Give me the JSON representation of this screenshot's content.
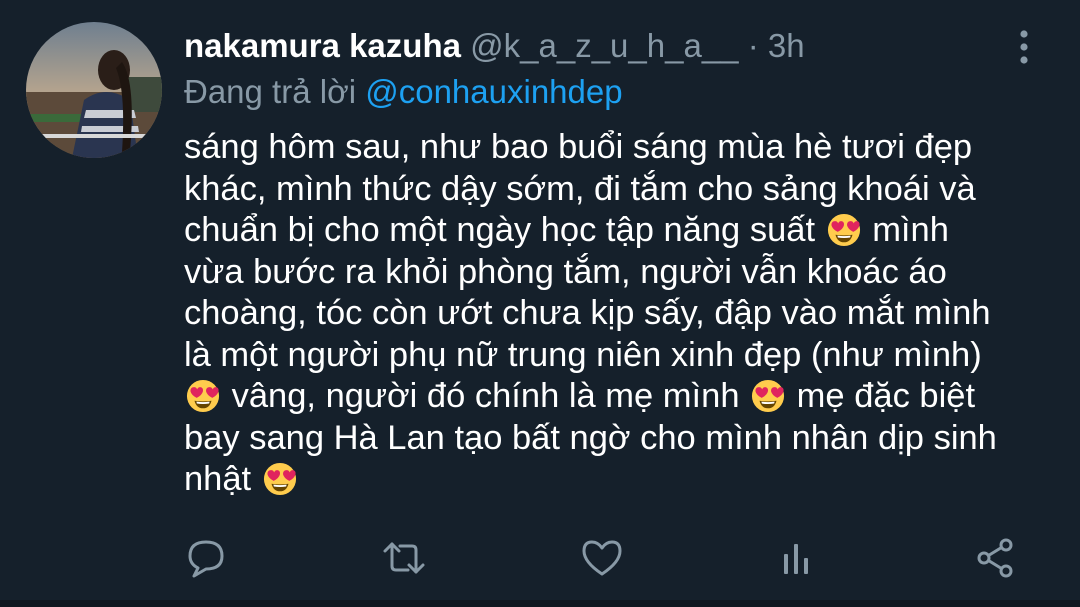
{
  "tweet": {
    "display_name": "nakamura kazuha",
    "handle": "@k_a_z_u_h_a__",
    "separator": "·",
    "time": "3h",
    "reply_prefix": "Đang trả lời",
    "reply_to": "@conhauxinhdep",
    "body_lines": [
      [
        "sáng hôm sau, như bao buổi sáng mùa hè tươi đẹp"
      ],
      [
        "khác, mình thức dậy sớm, đi tắm cho sảng khoái và"
      ],
      [
        "chuẩn bị cho một ngày học tập năng suất ",
        " mình"
      ],
      [
        "vừa bước ra khỏi phòng tắm, người vẫn khoác áo"
      ],
      [
        "choàng, tóc còn ướt chưa kịp sấy, đập vào mắt mình"
      ],
      [
        "là một người phụ nữ trung niên xinh đẹp (như mình)"
      ],
      [
        "",
        " vâng, người đó chính là mẹ mình ",
        " mẹ đặc biệt"
      ],
      [
        "bay sang Hà Lan tạo bất ngờ cho mình nhân dịp sinh"
      ],
      [
        "nhật ",
        ""
      ]
    ],
    "emoji_name": "smiling-face-with-heart-eyes"
  },
  "icons": {
    "more": "more-vertical-icon",
    "reply": "reply-icon",
    "retweet": "retweet-icon",
    "like": "heart-icon",
    "analytics": "analytics-icon",
    "share": "share-icon"
  },
  "colors": {
    "background": "#15202b",
    "text": "#ffffff",
    "secondary": "#8899a6",
    "accent": "#1da1f2"
  }
}
